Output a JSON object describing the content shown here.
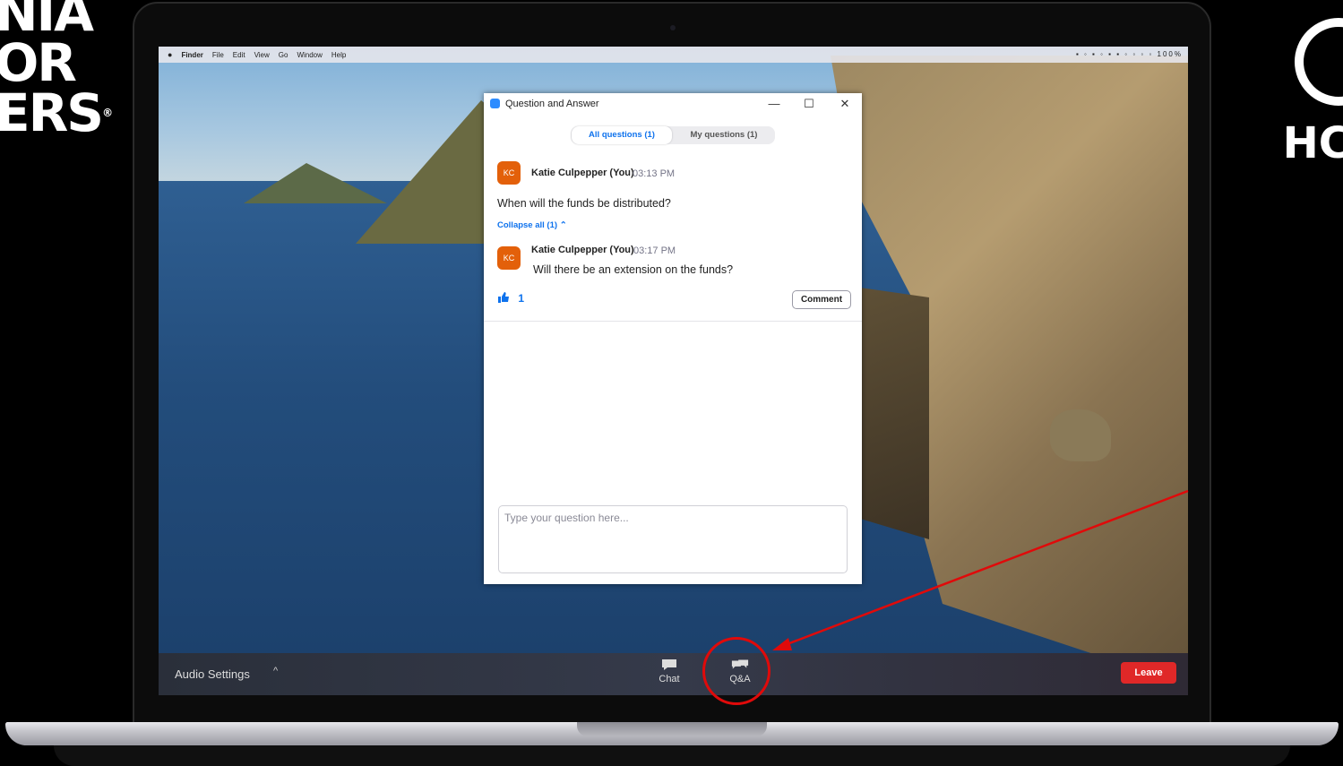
{
  "background_logos": {
    "left_lines": [
      "NIA",
      "OR",
      "ERS"
    ],
    "left_reg_mark": "®",
    "right_text": "HC"
  },
  "mac_menubar": {
    "apple": "",
    "items": [
      "Finder",
      "File",
      "Edit",
      "View",
      "Go",
      "Window",
      "Help"
    ],
    "status": "100%"
  },
  "qa_window": {
    "title": "Question and Answer",
    "controls": {
      "minimize": "—",
      "maximize": "☐",
      "close": "✕"
    },
    "tabs": [
      {
        "label": "All questions (1)",
        "active": true
      },
      {
        "label": "My questions (1)",
        "active": false
      }
    ],
    "question": {
      "avatar": "KC",
      "author": "Katie Culpepper (You)",
      "time": "03:13 PM",
      "text": "When will the funds be distributed?"
    },
    "collapse_label": "Collapse all (1)",
    "collapse_icon": "⌃",
    "reply": {
      "avatar": "KC",
      "author": "Katie Culpepper (You)",
      "time": "03:17 PM",
      "text": "Will there be an extension on the funds?"
    },
    "like_count": "1",
    "comment_label": "Comment",
    "input_placeholder": "Type your question here..."
  },
  "toolbar": {
    "audio_label": "Audio Settings",
    "caret": "^",
    "chat_label": "Chat",
    "qa_label": "Q&A",
    "leave_label": "Leave"
  },
  "colors": {
    "accent": "#0e72ed",
    "avatar": "#e3600a",
    "leave": "#e02828",
    "annotation": "#e00a0a"
  }
}
